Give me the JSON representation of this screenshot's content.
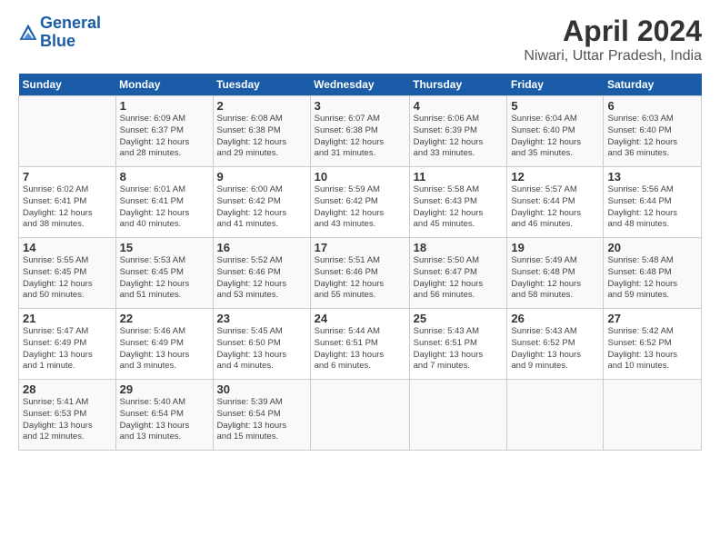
{
  "header": {
    "logo_line1": "General",
    "logo_line2": "Blue",
    "title": "April 2024",
    "subtitle": "Niwari, Uttar Pradesh, India"
  },
  "columns": [
    "Sunday",
    "Monday",
    "Tuesday",
    "Wednesday",
    "Thursday",
    "Friday",
    "Saturday"
  ],
  "weeks": [
    [
      {
        "day": "",
        "info": ""
      },
      {
        "day": "1",
        "info": "Sunrise: 6:09 AM\nSunset: 6:37 PM\nDaylight: 12 hours\nand 28 minutes."
      },
      {
        "day": "2",
        "info": "Sunrise: 6:08 AM\nSunset: 6:38 PM\nDaylight: 12 hours\nand 29 minutes."
      },
      {
        "day": "3",
        "info": "Sunrise: 6:07 AM\nSunset: 6:38 PM\nDaylight: 12 hours\nand 31 minutes."
      },
      {
        "day": "4",
        "info": "Sunrise: 6:06 AM\nSunset: 6:39 PM\nDaylight: 12 hours\nand 33 minutes."
      },
      {
        "day": "5",
        "info": "Sunrise: 6:04 AM\nSunset: 6:40 PM\nDaylight: 12 hours\nand 35 minutes."
      },
      {
        "day": "6",
        "info": "Sunrise: 6:03 AM\nSunset: 6:40 PM\nDaylight: 12 hours\nand 36 minutes."
      }
    ],
    [
      {
        "day": "7",
        "info": "Sunrise: 6:02 AM\nSunset: 6:41 PM\nDaylight: 12 hours\nand 38 minutes."
      },
      {
        "day": "8",
        "info": "Sunrise: 6:01 AM\nSunset: 6:41 PM\nDaylight: 12 hours\nand 40 minutes."
      },
      {
        "day": "9",
        "info": "Sunrise: 6:00 AM\nSunset: 6:42 PM\nDaylight: 12 hours\nand 41 minutes."
      },
      {
        "day": "10",
        "info": "Sunrise: 5:59 AM\nSunset: 6:42 PM\nDaylight: 12 hours\nand 43 minutes."
      },
      {
        "day": "11",
        "info": "Sunrise: 5:58 AM\nSunset: 6:43 PM\nDaylight: 12 hours\nand 45 minutes."
      },
      {
        "day": "12",
        "info": "Sunrise: 5:57 AM\nSunset: 6:44 PM\nDaylight: 12 hours\nand 46 minutes."
      },
      {
        "day": "13",
        "info": "Sunrise: 5:56 AM\nSunset: 6:44 PM\nDaylight: 12 hours\nand 48 minutes."
      }
    ],
    [
      {
        "day": "14",
        "info": "Sunrise: 5:55 AM\nSunset: 6:45 PM\nDaylight: 12 hours\nand 50 minutes."
      },
      {
        "day": "15",
        "info": "Sunrise: 5:53 AM\nSunset: 6:45 PM\nDaylight: 12 hours\nand 51 minutes."
      },
      {
        "day": "16",
        "info": "Sunrise: 5:52 AM\nSunset: 6:46 PM\nDaylight: 12 hours\nand 53 minutes."
      },
      {
        "day": "17",
        "info": "Sunrise: 5:51 AM\nSunset: 6:46 PM\nDaylight: 12 hours\nand 55 minutes."
      },
      {
        "day": "18",
        "info": "Sunrise: 5:50 AM\nSunset: 6:47 PM\nDaylight: 12 hours\nand 56 minutes."
      },
      {
        "day": "19",
        "info": "Sunrise: 5:49 AM\nSunset: 6:48 PM\nDaylight: 12 hours\nand 58 minutes."
      },
      {
        "day": "20",
        "info": "Sunrise: 5:48 AM\nSunset: 6:48 PM\nDaylight: 12 hours\nand 59 minutes."
      }
    ],
    [
      {
        "day": "21",
        "info": "Sunrise: 5:47 AM\nSunset: 6:49 PM\nDaylight: 13 hours\nand 1 minute."
      },
      {
        "day": "22",
        "info": "Sunrise: 5:46 AM\nSunset: 6:49 PM\nDaylight: 13 hours\nand 3 minutes."
      },
      {
        "day": "23",
        "info": "Sunrise: 5:45 AM\nSunset: 6:50 PM\nDaylight: 13 hours\nand 4 minutes."
      },
      {
        "day": "24",
        "info": "Sunrise: 5:44 AM\nSunset: 6:51 PM\nDaylight: 13 hours\nand 6 minutes."
      },
      {
        "day": "25",
        "info": "Sunrise: 5:43 AM\nSunset: 6:51 PM\nDaylight: 13 hours\nand 7 minutes."
      },
      {
        "day": "26",
        "info": "Sunrise: 5:43 AM\nSunset: 6:52 PM\nDaylight: 13 hours\nand 9 minutes."
      },
      {
        "day": "27",
        "info": "Sunrise: 5:42 AM\nSunset: 6:52 PM\nDaylight: 13 hours\nand 10 minutes."
      }
    ],
    [
      {
        "day": "28",
        "info": "Sunrise: 5:41 AM\nSunset: 6:53 PM\nDaylight: 13 hours\nand 12 minutes."
      },
      {
        "day": "29",
        "info": "Sunrise: 5:40 AM\nSunset: 6:54 PM\nDaylight: 13 hours\nand 13 minutes."
      },
      {
        "day": "30",
        "info": "Sunrise: 5:39 AM\nSunset: 6:54 PM\nDaylight: 13 hours\nand 15 minutes."
      },
      {
        "day": "",
        "info": ""
      },
      {
        "day": "",
        "info": ""
      },
      {
        "day": "",
        "info": ""
      },
      {
        "day": "",
        "info": ""
      }
    ]
  ]
}
